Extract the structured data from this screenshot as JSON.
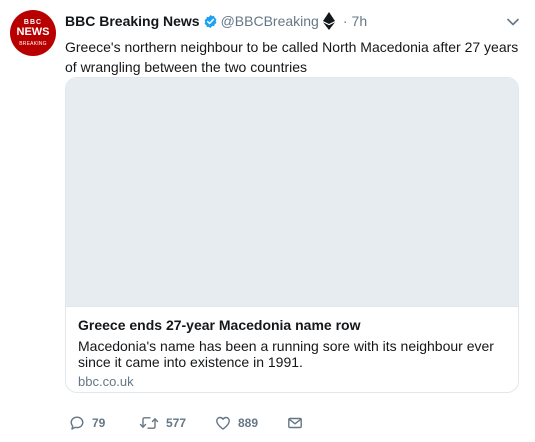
{
  "tweet": {
    "avatar": {
      "line1": "BBC",
      "line2": "NEWS",
      "line3": "BREAKING"
    },
    "author_name": "BBC Breaking News",
    "handle": "@BBCBreaking",
    "separator": "·",
    "time": "7h",
    "text": "Greece's northern neighbour to be called North Macedonia after 27 years of wrangling between the two countries",
    "card": {
      "title": "Greece ends 27-year Macedonia name row",
      "description": "Macedonia's name has been a running sore with its neighbour ever since it came into existence in 1991.",
      "domain": "bbc.co.uk"
    },
    "actions": {
      "replies": "79",
      "retweets": "577",
      "likes": "889"
    }
  },
  "icons": {
    "verified": "verified-badge-icon",
    "ethereum": "ethereum-icon",
    "caret": "chevron-down-icon",
    "reply": "reply-icon",
    "retweet": "retweet-icon",
    "like": "heart-icon",
    "message": "envelope-icon"
  },
  "colors": {
    "avatar_bg": "#b80000",
    "verified": "#1da1f2",
    "secondary_text": "#657786",
    "card_border": "#e1e8ed",
    "card_image_bg": "#e6ecf0"
  }
}
